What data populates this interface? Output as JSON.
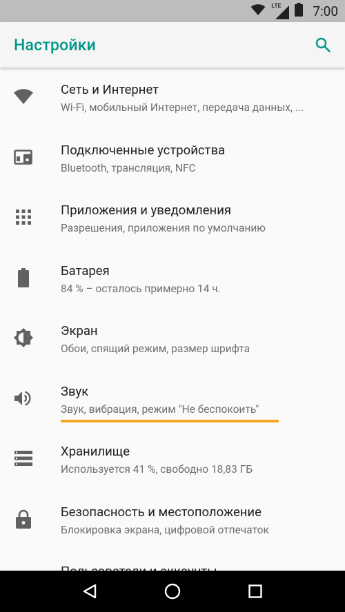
{
  "status_bar": {
    "time": "7:00",
    "network_type": "LTE",
    "icons": [
      "wifi-icon",
      "lte-signal-icon",
      "battery-icon"
    ]
  },
  "app_bar": {
    "title": "Настройки",
    "search_icon": "search-icon",
    "accent_color": "#009688"
  },
  "settings": {
    "items": [
      {
        "title": "Сеть и Интернет",
        "summary": "Wi-Fi, мобильный Интернет, передача данных, ...",
        "icon": "wifi-icon"
      },
      {
        "title": "Подключенные устройства",
        "summary": "Bluetooth, трансляция, NFC",
        "icon": "connected-devices-icon"
      },
      {
        "title": "Приложения и уведомления",
        "summary": "Разрешения, приложения по умолчанию",
        "icon": "apps-grid-icon"
      },
      {
        "title": "Батарея",
        "summary": "84 % – осталось примерно 14 ч.",
        "icon": "battery-icon"
      },
      {
        "title": "Экран",
        "summary": "Обои, спящий режим, размер шрифта",
        "icon": "brightness-icon"
      },
      {
        "title": "Звук",
        "summary": "Звук, вибрация, режим \"Не беспокоить\"",
        "icon": "volume-icon",
        "highlighted": true,
        "highlight_color": "#f5a623"
      },
      {
        "title": "Хранилище",
        "summary": "Используется 41 %, свободно 18,83 ГБ",
        "icon": "storage-icon"
      },
      {
        "title": "Безопасность и местоположение",
        "summary": "Блокировка экрана, цифровой отпечаток",
        "icon": "lock-icon"
      },
      {
        "title": "Пользователи и аккаунты",
        "summary": "",
        "icon": "account-icon"
      }
    ]
  },
  "nav_bar": {
    "buttons": [
      "back-icon",
      "home-icon",
      "recents-icon"
    ]
  }
}
